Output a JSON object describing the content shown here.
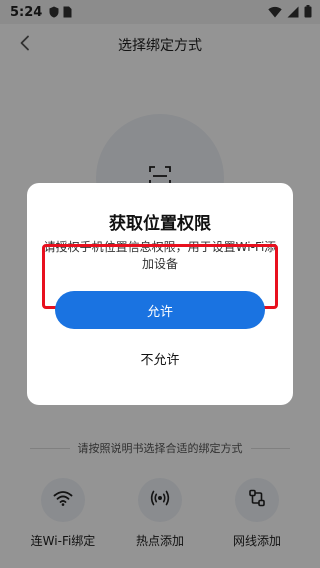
{
  "status_bar": {
    "time": "5:24",
    "left_icons": [
      "shield-icon",
      "sim-card-icon"
    ],
    "right_icons": [
      "wifi-icon",
      "signal-icon",
      "battery-icon"
    ]
  },
  "header": {
    "back_icon": "chevron-left-icon",
    "title": "选择绑定方式"
  },
  "scan": {
    "icon": "scan-icon"
  },
  "divider": {
    "text": "请按照说明书选择合适的绑定方式"
  },
  "methods": [
    {
      "label": "连Wi-Fi绑定",
      "icon": "wifi-icon"
    },
    {
      "label": "热点添加",
      "icon": "hotspot-icon"
    },
    {
      "label": "网线添加",
      "icon": "ethernet-icon"
    }
  ],
  "dialog": {
    "title": "获取位置权限",
    "message": "请授权手机位置信息权限，用于设置Wi-Fi添加设备",
    "allow_label": "允许",
    "deny_label": "不允许"
  },
  "colors": {
    "primary": "#1a73e1",
    "highlight": "#e8101e"
  }
}
